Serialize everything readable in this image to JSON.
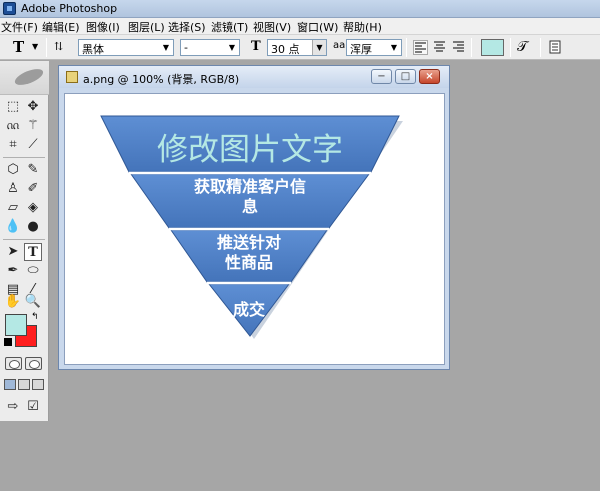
{
  "app": {
    "title": "Adobe Photoshop"
  },
  "menu": [
    "文件(F)",
    "编辑(E)",
    "图像(I)",
    "图层(L)",
    "选择(S)",
    "滤镜(T)",
    "视图(V)",
    "窗口(W)",
    "帮助(H)"
  ],
  "options": {
    "tool_letter": "T",
    "font_family": "黑体",
    "font_style": "-",
    "font_size_glyph": "T",
    "font_size": "30 点",
    "antialias_glyph": "aa",
    "antialias": "浑厚",
    "text_color": "#b4e8e4"
  },
  "toolbox": {
    "foreground_color": "#b4e8e4",
    "background_color": "#ff1e1e"
  },
  "document": {
    "title": "a.png @ 100% (背景, RGB/8)",
    "minimize_label": "−",
    "maximize_label": "□",
    "close_label": "×"
  },
  "pyramid": {
    "fill": "#4f7fc4",
    "title": "修改图片文字",
    "title_color": "#b4e8e4",
    "level1": [
      "获取精准客户信",
      "息"
    ],
    "level2": [
      "推送针对",
      "性商品"
    ],
    "level3": "成交"
  }
}
